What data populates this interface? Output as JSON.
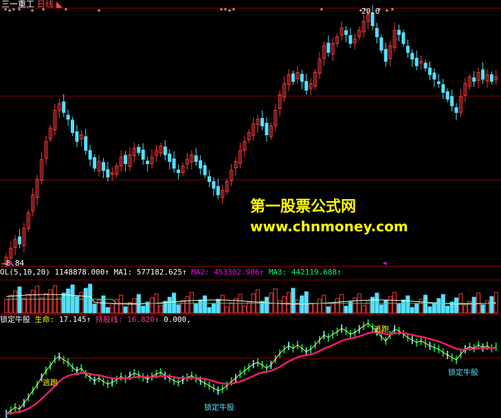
{
  "header": {
    "stock_name": "三一重工",
    "period": "日线",
    "high_label": "20.0",
    "low_label": "8.84"
  },
  "watermark": {
    "line1": "第一股票公式网",
    "line2": "www.chnmoney.com"
  },
  "volume_panel": {
    "indicator": "OL(5,10,20)",
    "vol": "1148878.000↑",
    "ma1_label": "MA1:",
    "ma1": "577182.625↑",
    "ma2_label": "MA2:",
    "ma2": "453302.906↑",
    "ma3_label": "MA3:",
    "ma3": "442119.688↑"
  },
  "indicator_panel": {
    "name": "锁定牛股",
    "life_label": "生命:",
    "life_value": "17.145↑",
    "hold_label": "持股线:",
    "hold_value": "16.820↑",
    "third_value": "0.000,",
    "annotations": [
      "逃跑",
      "逃跑",
      "锁定牛股",
      "锁定牛股"
    ]
  },
  "colors": {
    "up": "#ff3b3b",
    "down": "#55e0ff",
    "grid": "#8b0000",
    "ma_yellow": "#ffff66",
    "hold_line": "#ff1a6a"
  },
  "chart_data": {
    "type": "candlestick",
    "y_max": 20.0,
    "y_min": 8.84,
    "closes": [
      9.0,
      9.4,
      9.8,
      9.6,
      10.3,
      11.0,
      11.8,
      12.5,
      13.4,
      14.2,
      14.8,
      15.6,
      15.9,
      15.5,
      15.2,
      14.6,
      14.2,
      14.5,
      13.8,
      13.4,
      13.0,
      13.3,
      12.9,
      12.6,
      12.8,
      13.1,
      13.5,
      13.2,
      13.6,
      13.9,
      13.7,
      13.4,
      13.2,
      13.5,
      13.8,
      14.0,
      13.6,
      13.3,
      13.0,
      12.8,
      13.1,
      13.4,
      13.6,
      13.3,
      13.0,
      12.7,
      12.4,
      12.1,
      11.8,
      12.0,
      12.4,
      12.9,
      13.3,
      13.8,
      14.2,
      14.6,
      15.0,
      15.2,
      14.9,
      14.5,
      14.9,
      15.6,
      16.3,
      16.8,
      17.2,
      16.9,
      17.3,
      16.9,
      16.5,
      16.8,
      17.3,
      17.9,
      18.5,
      18.2,
      18.6,
      18.9,
      19.3,
      19.0,
      18.6,
      18.8,
      19.2,
      19.6,
      19.9,
      19.4,
      18.9,
      18.3,
      17.8,
      18.5,
      19.2,
      19.0,
      18.6,
      18.2,
      17.9,
      17.6,
      17.8,
      17.5,
      17.2,
      17.0,
      16.8,
      16.4,
      16.1,
      15.8,
      15.5,
      16.2,
      16.8,
      17.1,
      16.9,
      17.3,
      17.0,
      17.2,
      16.9,
      17.1
    ]
  }
}
